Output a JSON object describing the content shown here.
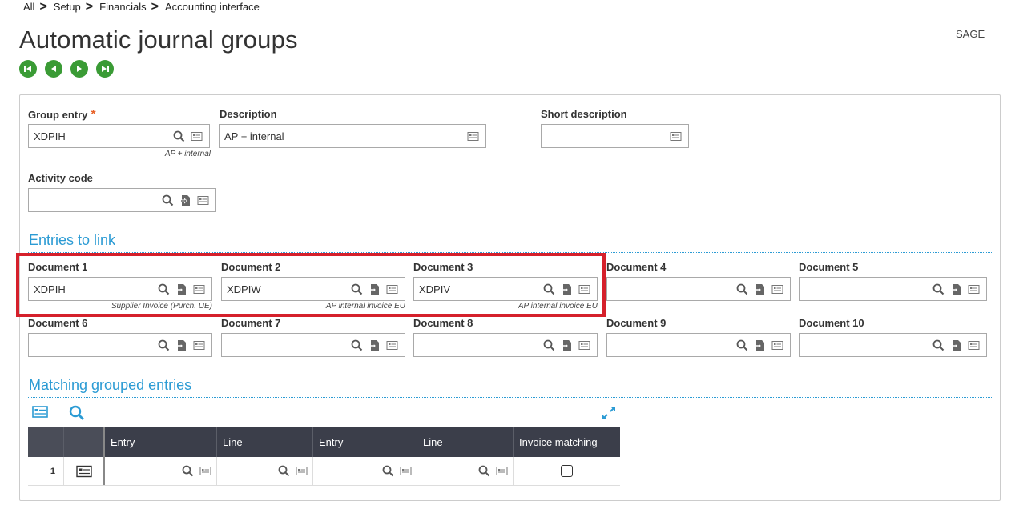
{
  "breadcrumb": [
    "All",
    "Setup",
    "Financials",
    "Accounting interface"
  ],
  "page": {
    "title": "Automatic journal groups",
    "user": "SAGE"
  },
  "nav": [
    "first",
    "previous",
    "next",
    "last"
  ],
  "header": {
    "group_entry": {
      "label": "Group entry",
      "required": "*",
      "value": "XDPIH",
      "hint": "AP + internal"
    },
    "description": {
      "label": "Description",
      "value": "AP + internal"
    },
    "short_description": {
      "label": "Short description",
      "value": ""
    },
    "activity_code": {
      "label": "Activity code",
      "value": ""
    }
  },
  "entries_section": {
    "title": "Entries to link",
    "documents": [
      {
        "label": "Document 1",
        "value": "XDPIH",
        "hint": "Supplier Invoice (Purch. UE)"
      },
      {
        "label": "Document 2",
        "value": "XDPIW",
        "hint": "AP internal invoice EU"
      },
      {
        "label": "Document 3",
        "value": "XDPIV",
        "hint": "AP internal invoice EU"
      },
      {
        "label": "Document 4",
        "value": "",
        "hint": ""
      },
      {
        "label": "Document 5",
        "value": "",
        "hint": ""
      },
      {
        "label": "Document 6",
        "value": "",
        "hint": ""
      },
      {
        "label": "Document 7",
        "value": "",
        "hint": ""
      },
      {
        "label": "Document 8",
        "value": "",
        "hint": ""
      },
      {
        "label": "Document 9",
        "value": "",
        "hint": ""
      },
      {
        "label": "Document 10",
        "value": "",
        "hint": ""
      }
    ]
  },
  "matching_section": {
    "title": "Matching grouped entries",
    "columns": [
      "Entry",
      "Line",
      "Entry",
      "Line",
      "Invoice matching"
    ],
    "rows": [
      {
        "num": "1",
        "entry1": "",
        "line1": "",
        "entry2": "",
        "line2": "",
        "invoice_matching": false
      }
    ]
  },
  "colors": {
    "accent": "#2b9bd4",
    "nav_green": "#3a9b35",
    "highlight_red": "#d5202b",
    "grid_header": "#3b3e4a"
  }
}
